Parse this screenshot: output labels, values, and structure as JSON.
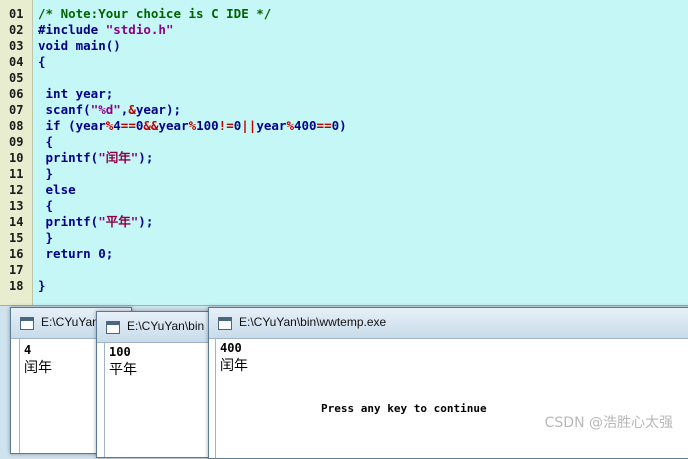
{
  "editor": {
    "lines": [
      {
        "num": "01",
        "parts": [
          {
            "t": "/* Note:Your choice is C IDE */",
            "c": "comment"
          }
        ]
      },
      {
        "num": "02",
        "parts": [
          {
            "t": "#include ",
            "c": "pp"
          },
          {
            "t": "\"stdio.h\"",
            "c": "str"
          }
        ]
      },
      {
        "num": "03",
        "parts": [
          {
            "t": "void main()",
            "c": "kw"
          }
        ]
      },
      {
        "num": "04",
        "parts": [
          {
            "t": "{",
            "c": "kw"
          }
        ]
      },
      {
        "num": "05",
        "parts": []
      },
      {
        "num": "06",
        "parts": [
          {
            "t": " int year;",
            "c": "kw"
          }
        ]
      },
      {
        "num": "07",
        "parts": [
          {
            "t": " scanf(",
            "c": "kw"
          },
          {
            "t": "\"%d\"",
            "c": "str"
          },
          {
            "t": ",",
            "c": "kw"
          },
          {
            "t": "&",
            "c": "op"
          },
          {
            "t": "year);",
            "c": "kw"
          }
        ]
      },
      {
        "num": "08",
        "parts": [
          {
            "t": " if (year",
            "c": "kw"
          },
          {
            "t": "%",
            "c": "op"
          },
          {
            "t": "4",
            "c": "kw"
          },
          {
            "t": "==",
            "c": "op"
          },
          {
            "t": "0",
            "c": "kw"
          },
          {
            "t": "&&",
            "c": "op"
          },
          {
            "t": "year",
            "c": "kw"
          },
          {
            "t": "%",
            "c": "op"
          },
          {
            "t": "100",
            "c": "kw"
          },
          {
            "t": "!=",
            "c": "op"
          },
          {
            "t": "0",
            "c": "kw"
          },
          {
            "t": "||",
            "c": "op"
          },
          {
            "t": "year",
            "c": "kw"
          },
          {
            "t": "%",
            "c": "op"
          },
          {
            "t": "400",
            "c": "kw"
          },
          {
            "t": "==",
            "c": "op"
          },
          {
            "t": "0)",
            "c": "kw"
          }
        ]
      },
      {
        "num": "09",
        "parts": [
          {
            "t": " {",
            "c": "kw"
          }
        ]
      },
      {
        "num": "10",
        "parts": [
          {
            "t": " printf(",
            "c": "kw"
          },
          {
            "t": "\"",
            "c": "str"
          },
          {
            "t": "闰年",
            "c": "cn"
          },
          {
            "t": "\"",
            "c": "str"
          },
          {
            "t": ");",
            "c": "kw"
          }
        ]
      },
      {
        "num": "11",
        "parts": [
          {
            "t": " }",
            "c": "kw"
          }
        ]
      },
      {
        "num": "12",
        "parts": [
          {
            "t": " else",
            "c": "kw"
          }
        ]
      },
      {
        "num": "13",
        "parts": [
          {
            "t": " {",
            "c": "kw"
          }
        ]
      },
      {
        "num": "14",
        "parts": [
          {
            "t": " printf(",
            "c": "kw"
          },
          {
            "t": "\"",
            "c": "str"
          },
          {
            "t": "平年",
            "c": "cn"
          },
          {
            "t": "\"",
            "c": "str"
          },
          {
            "t": ");",
            "c": "kw"
          }
        ]
      },
      {
        "num": "15",
        "parts": [
          {
            "t": " }",
            "c": "kw"
          }
        ]
      },
      {
        "num": "16",
        "parts": [
          {
            "t": " return 0;",
            "c": "kw"
          }
        ]
      },
      {
        "num": "17",
        "parts": []
      },
      {
        "num": "18",
        "parts": [
          {
            "t": "}",
            "c": "kw"
          }
        ]
      }
    ]
  },
  "windows": [
    {
      "title": "E:\\CYuYan",
      "input": "4",
      "result": "闰年"
    },
    {
      "title": "E:\\CYuYan\\bin",
      "input": "100",
      "result": "平年"
    },
    {
      "title": "E:\\CYuYan\\bin\\wwtemp.exe",
      "input": "400",
      "result": "闰年",
      "prompt": "Press any key to continue"
    }
  ],
  "watermark": "CSDN @浩胜心太强"
}
